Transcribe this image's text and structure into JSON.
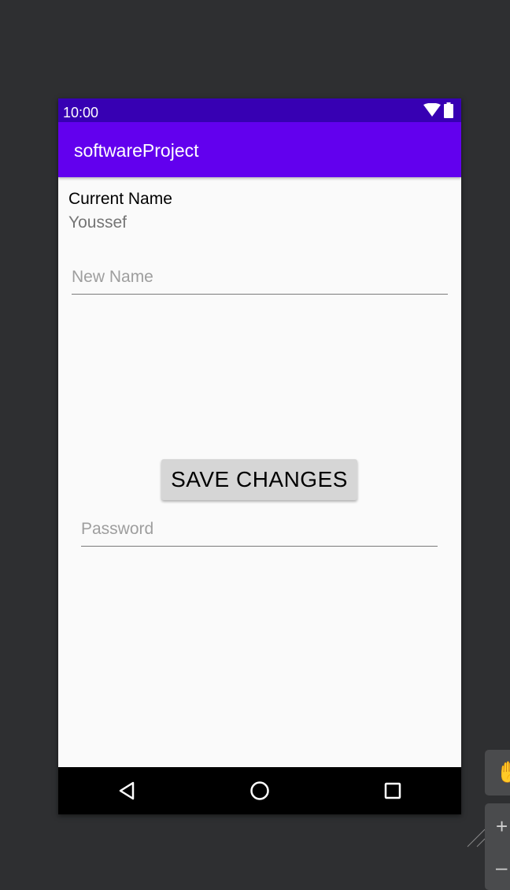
{
  "status_bar": {
    "time": "10:00"
  },
  "app_bar": {
    "title": "softwareProject"
  },
  "profile": {
    "current_name_label": "Current Name",
    "current_name_value": "Youssef"
  },
  "form": {
    "new_name_placeholder": "New Name",
    "new_name_value": "",
    "save_button_label": "SAVE CHANGES",
    "password_placeholder": "Password",
    "password_value": ""
  },
  "nav_bar": {
    "icons": [
      "back-triangle-icon",
      "home-circle-icon",
      "recents-square-icon"
    ]
  },
  "editor_tools": {
    "icons": [
      "hand-pan-icon",
      "zoom-in-icon",
      "zoom-out-icon"
    ]
  },
  "colors": {
    "status_bar": "#3700b3",
    "app_bar": "#6200ee",
    "screen_background": "#fafafa",
    "button_background": "#d6d6d6",
    "nav_bar": "#000000",
    "editor_background": "#2e2f31"
  }
}
